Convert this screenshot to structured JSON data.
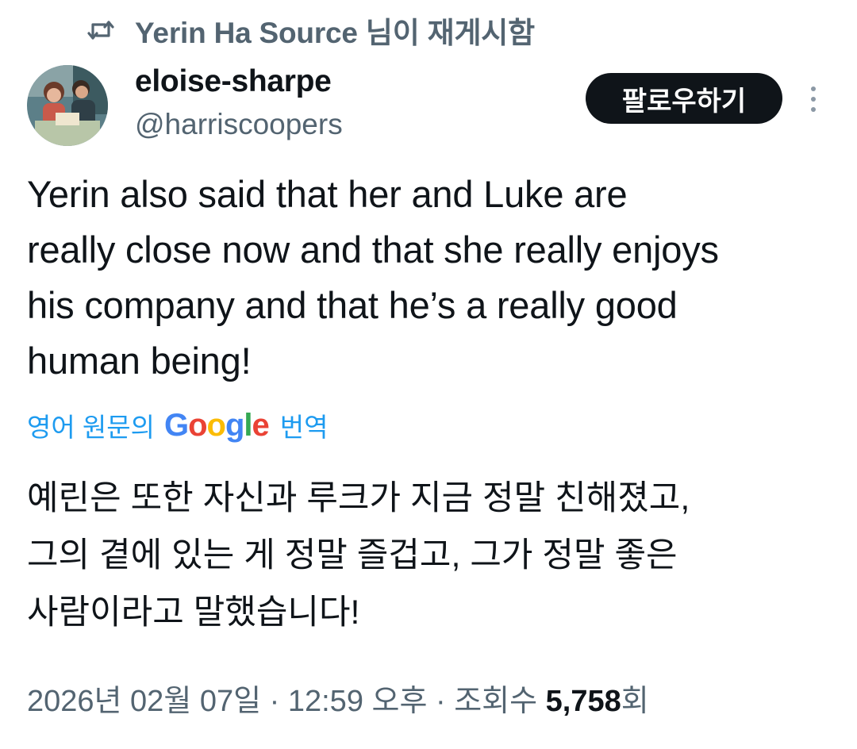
{
  "repost": {
    "label": "Yerin Ha Source 님이 재게시함",
    "icon": "repost-icon"
  },
  "author": {
    "display_name": "eloise-sharpe",
    "handle": "@harriscoopers",
    "avatar": "avatar"
  },
  "follow_button": {
    "label": "팔로우하기"
  },
  "more_menu": {
    "icon": "more-vertical-icon"
  },
  "tweet": {
    "text": "Yerin also said that her and Luke are\nreally close now and that she really enjoys\nhis company and that he’s a really good\nhuman being!"
  },
  "translation": {
    "prefix": "영어 원문의",
    "google_letters": [
      "G",
      "o",
      "o",
      "g",
      "l",
      "e"
    ],
    "google_colors": [
      "#4285F4",
      "#EA4335",
      "#FBBC05",
      "#4285F4",
      "#34A853",
      "#EA4335"
    ],
    "suffix": "번역",
    "text": "예린은 또한 자신과 루크가 지금 정말 친해졌고,\n그의 곁에 있는 게 정말 즐겁고, 그가 정말 좋은\n사람이라고 말했습니다!"
  },
  "meta": {
    "date": "2026년 02월 07일",
    "separator": "·",
    "time": "12:59 오후",
    "views_label": "조회수",
    "views_count": "5,758",
    "views_suffix": "회"
  },
  "colors": {
    "text": "#0f1419",
    "secondary": "#536471",
    "link": "#1d9bf0",
    "button_bg": "#0f1419"
  }
}
